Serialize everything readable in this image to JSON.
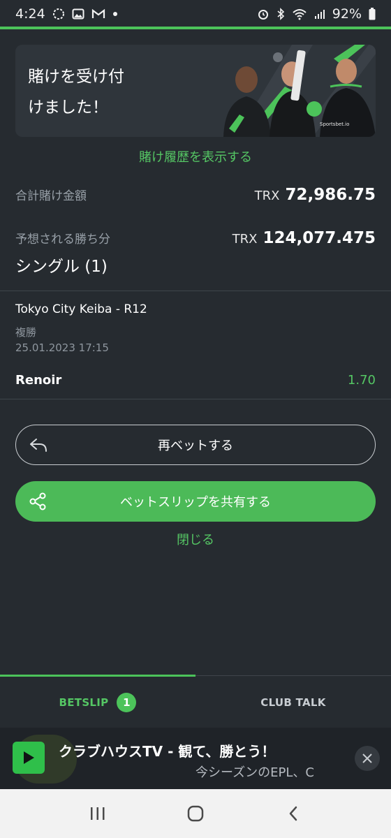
{
  "status_bar": {
    "time": "4:24",
    "battery": "92%"
  },
  "banner": {
    "title": "賭けを受け付\nけました！",
    "brand_text": "Sportsbet.io"
  },
  "links": {
    "view_history": "賭け履歴を表示する",
    "close": "閉じる"
  },
  "summary": {
    "total_stake_label": "合計賭け金額",
    "total_stake_currency": "TRX",
    "total_stake_value": "72,986.75",
    "expected_win_label": "予想される勝ち分",
    "expected_win_currency": "TRX",
    "expected_win_value": "124,077.475",
    "bet_type": "シングル (1)"
  },
  "bet": {
    "event": "Tokyo City Keiba - R12",
    "market": "複勝",
    "datetime": "25.01.2023 17:15",
    "selection": "Renoir",
    "odds": "1.70"
  },
  "buttons": {
    "rebet": "再ベットする",
    "share": "ベットスリップを共有する"
  },
  "tabs": {
    "betslip": "BETSLIP",
    "betslip_count": "1",
    "club_talk": "CLUB TALK"
  },
  "promo": {
    "title": "クラブハウスTV - 観て、勝とう！",
    "subtitle": "今シーズンのEPL、C"
  },
  "colors": {
    "accent": "#4cc35a",
    "background": "#262b30",
    "banner_bg": "#2f353b"
  }
}
